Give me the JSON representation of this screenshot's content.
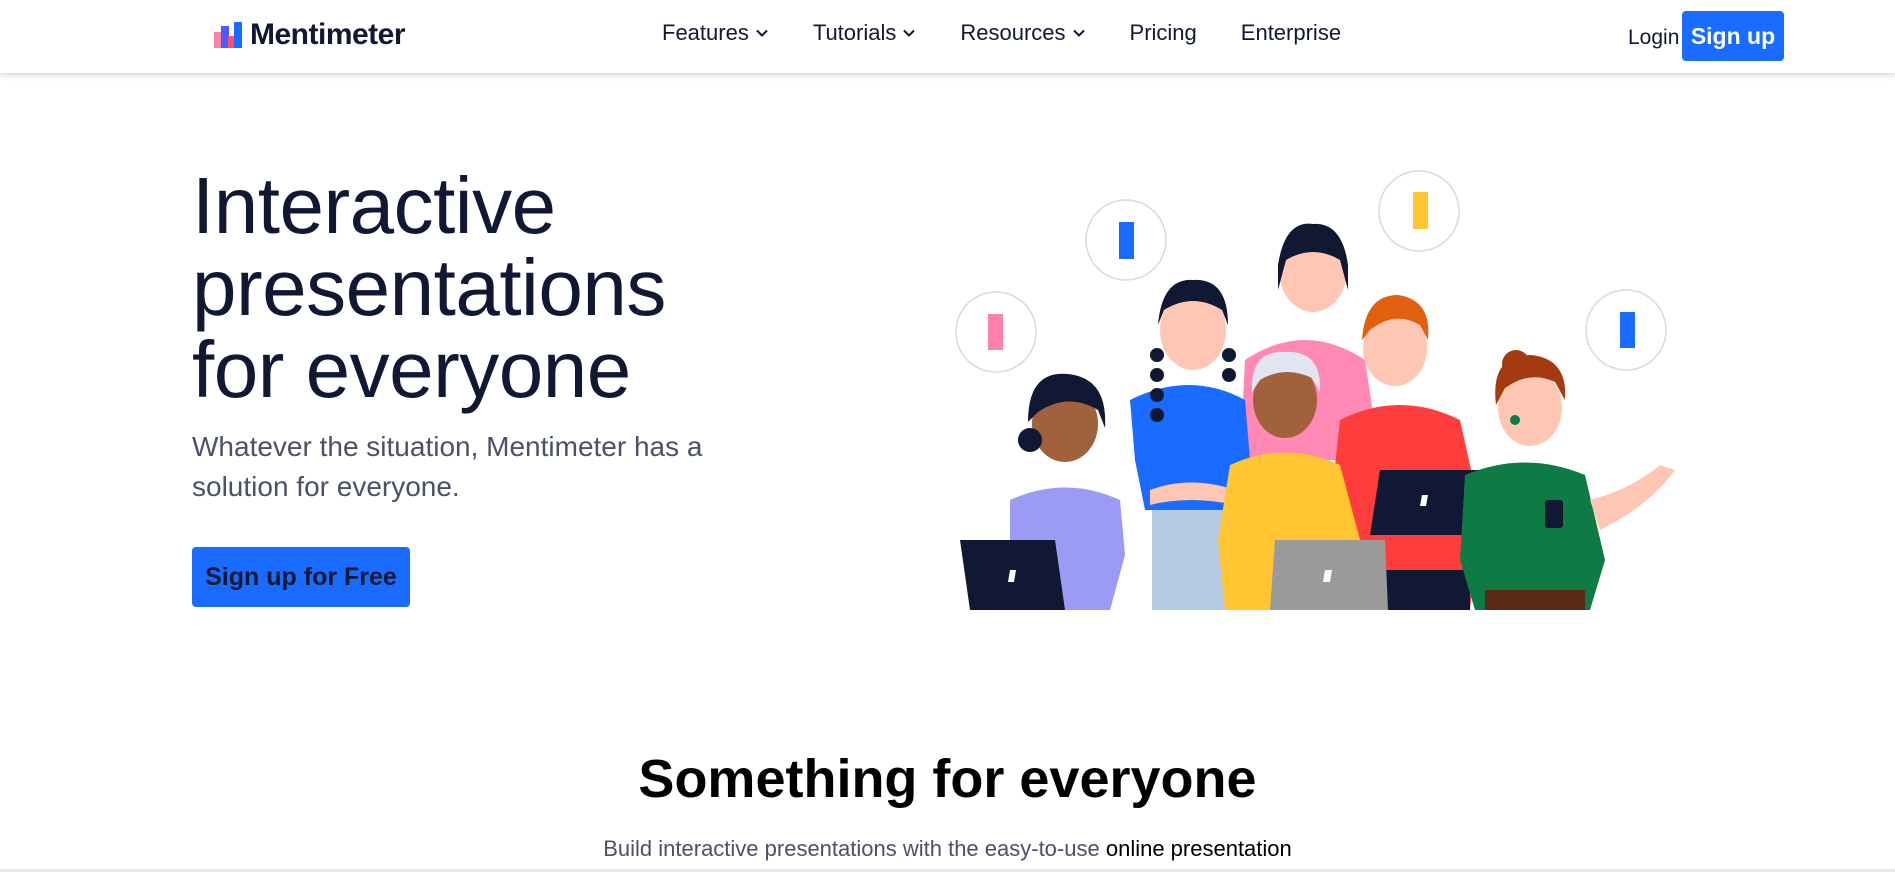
{
  "brand": {
    "name": "Mentimeter",
    "accent": "#196cff",
    "text": "#101834"
  },
  "nav": {
    "items": [
      {
        "label": "Features",
        "has_dropdown": true
      },
      {
        "label": "Tutorials",
        "has_dropdown": true
      },
      {
        "label": "Resources",
        "has_dropdown": true
      },
      {
        "label": "Pricing",
        "has_dropdown": false
      },
      {
        "label": "Enterprise",
        "has_dropdown": false
      }
    ],
    "login": "Login",
    "signup": "Sign up"
  },
  "hero": {
    "title_lines": [
      "Interactive",
      "presentations",
      "for everyone"
    ],
    "subtitle": "Whatever the situation, Mentimeter has a solution for everyone.",
    "cta": "Sign up for Free",
    "illustration_icon": "people-with-speech-bubbles-icon"
  },
  "section": {
    "title": "Something for everyone",
    "subtitle_prefix": "Build interactive presentations with the easy-to-use ",
    "subtitle_link": "online presentation"
  },
  "colors": {
    "bubble_pink": "#ff80ab",
    "bubble_blue": "#196cff",
    "bubble_yellow": "#ffc533",
    "shirt_purple": "#9b9bf5",
    "shirt_blue": "#196cff",
    "shirt_pink": "#ff89b4",
    "shirt_yellow": "#ffc533",
    "shirt_red": "#ff3d3d",
    "shirt_green": "#0e7a46"
  }
}
